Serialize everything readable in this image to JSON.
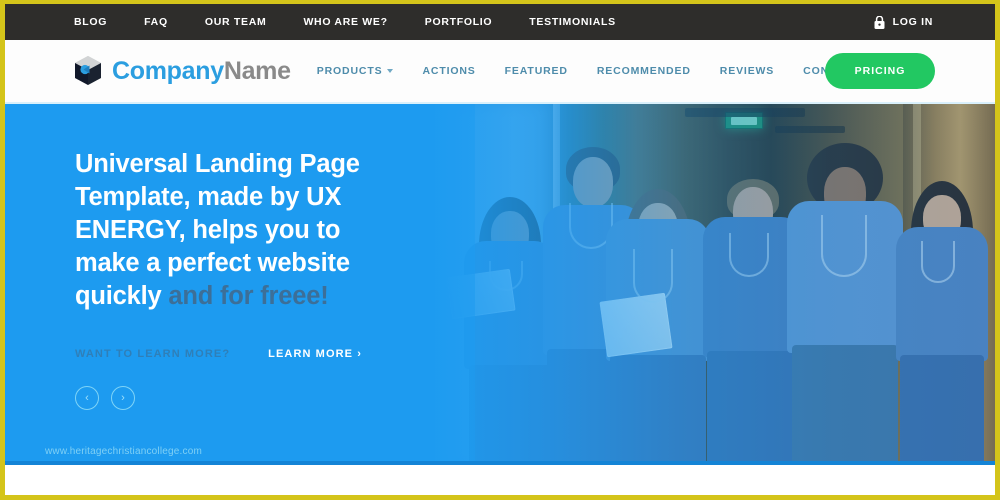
{
  "theme": {
    "frame_border": "#d4c41a",
    "topbar_bg": "#2e2d2b",
    "hero_blue": "#1d9bf0",
    "accent_green": "#22c862",
    "nav_link": "#4e8cab",
    "brand_blue": "#2b9ee0",
    "brand_gray": "#8a8a8a"
  },
  "topbar": {
    "items": [
      {
        "label": "BLOG"
      },
      {
        "label": "FAQ"
      },
      {
        "label": "OUR TEAM"
      },
      {
        "label": "WHO ARE WE?"
      },
      {
        "label": "PORTFOLIO"
      },
      {
        "label": "TESTIMONIALS"
      }
    ],
    "login": {
      "label": "LOG IN",
      "icon": "lock-icon"
    }
  },
  "header": {
    "brand": {
      "first": "Company",
      "second": "Name",
      "logo_icon": "cube-logo-icon"
    },
    "nav": [
      {
        "label": "PRODUCTS",
        "has_dropdown": true,
        "icon": "chevron-down-icon"
      },
      {
        "label": "ACTIONS",
        "has_dropdown": false
      },
      {
        "label": "FEATURED",
        "has_dropdown": false
      },
      {
        "label": "RECOMMENDED",
        "has_dropdown": false
      },
      {
        "label": "REVIEWS",
        "has_dropdown": false
      },
      {
        "label": "CONTACT US",
        "has_dropdown": false
      }
    ],
    "cta": {
      "label": "PRICING"
    }
  },
  "hero": {
    "headline_main": "Universal Landing Page Template, made by UX ENERGY, helps you to make a perfect website quickly",
    "headline_dim": " and for freee!",
    "want_more": "WANT TO LEARN MORE?",
    "learn_more": "LEARN MORE ›",
    "carousel": {
      "prev": "‹",
      "prev_name": "carousel-prev",
      "next": "›",
      "next_name": "carousel-next"
    },
    "watermark": "www.heritagechristiancollege.com",
    "image_alt": "group of six medical professionals in blue scrubs walking in a hospital corridor"
  }
}
